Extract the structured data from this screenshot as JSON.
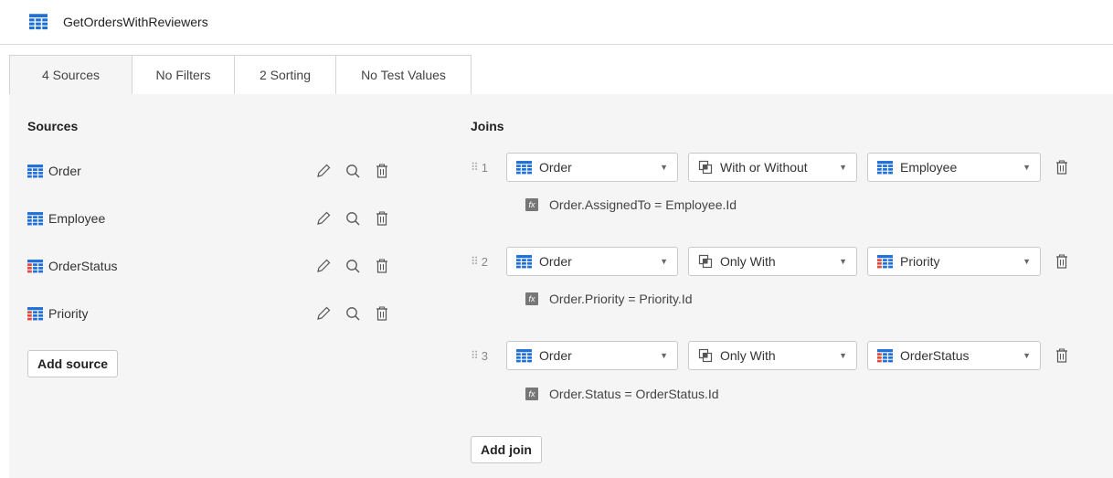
{
  "header": {
    "title": "GetOrdersWithReviewers",
    "icon": "table-icon",
    "icon_color": "#1e6fd9"
  },
  "tabs": [
    "4 Sources",
    "No Filters",
    "2 Sorting",
    "No Test Values"
  ],
  "sources": {
    "title": "Sources",
    "items": [
      {
        "name": "Order",
        "color": "#1e6fd9"
      },
      {
        "name": "Employee",
        "color": "#1e6fd9"
      },
      {
        "name": "OrderStatus",
        "color": "#e04a3f"
      },
      {
        "name": "Priority",
        "color": "#e04a3f"
      }
    ],
    "add_label": "Add source"
  },
  "joins": {
    "title": "Joins",
    "items": [
      {
        "num": "1",
        "left": "Order",
        "type": "With or Without",
        "right": "Employee",
        "right_color": "#1e6fd9",
        "condition": "Order.AssignedTo = Employee.Id"
      },
      {
        "num": "2",
        "left": "Order",
        "type": "Only With",
        "right": "Priority",
        "right_color": "#e04a3f",
        "condition": "Order.Priority = Priority.Id"
      },
      {
        "num": "3",
        "left": "Order",
        "type": "Only With",
        "right": "OrderStatus",
        "right_color": "#e04a3f",
        "condition": "Order.Status = OrderStatus.Id"
      }
    ],
    "add_label": "Add join"
  }
}
